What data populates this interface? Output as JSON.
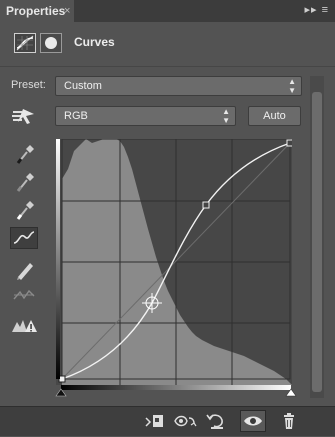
{
  "tab": {
    "title": "Properties",
    "close_glyph": "×",
    "menu_glyph": "▸▸ ≡"
  },
  "header": {
    "title": "Curves",
    "icons": [
      "curves-adjustment-icon",
      "layer-mask-icon"
    ]
  },
  "preset": {
    "label": "Preset:",
    "value": "Custom"
  },
  "channel": {
    "value": "RGB"
  },
  "auto_button": {
    "label": "Auto"
  },
  "tools": [
    "on-image-adjust-icon",
    "sample-black-point-icon",
    "sample-gray-point-icon",
    "sample-white-point-icon",
    "edit-points-curve-icon",
    "draw-curve-pencil-icon",
    "smooth-curve-icon",
    "clipping-warning-icon"
  ],
  "bottom_buttons": [
    "clip-to-layer-icon",
    "view-previous-state-icon",
    "reset-adjustments-icon",
    "toggle-visibility-icon",
    "delete-adjustment-icon"
  ],
  "colors": {
    "panel": "#535353",
    "graph_bg": "#474747",
    "histogram": "#8a8a8a",
    "curve": "#f2f2f2",
    "control_fill": "#6b6b6b"
  }
}
